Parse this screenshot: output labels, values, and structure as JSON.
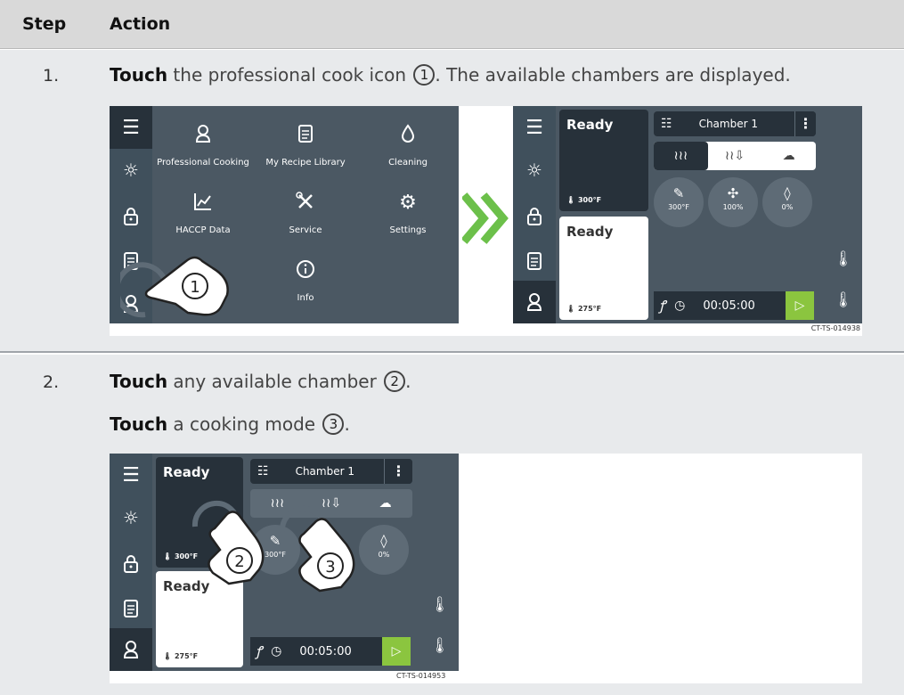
{
  "table": {
    "col_step": "Step",
    "col_action": "Action"
  },
  "steps": [
    {
      "num": "1.",
      "lines": [
        {
          "bold": "Touch",
          "text": " the professional cook icon ",
          "marker": "1",
          "after": ". The available chambers are displayed."
        }
      ],
      "figure": {
        "menu_screen": {
          "tiles": [
            {
              "icon": "chef-hat-icon",
              "label": "Professional Cooking"
            },
            {
              "icon": "recipe-book-icon",
              "label": "My Recipe Library"
            },
            {
              "icon": "droplet-icon",
              "label": "Cleaning"
            },
            {
              "icon": "chart-icon",
              "label": "HACCP Data"
            },
            {
              "icon": "tools-icon",
              "label": "Service"
            },
            {
              "icon": "gear-icon",
              "label": "Settings"
            },
            {
              "icon": "info-icon",
              "label": "Info"
            }
          ]
        },
        "arrow_color": "#6cc04a",
        "chamber_screen": {
          "top_card": {
            "status": "Ready",
            "temp": "300°F"
          },
          "bottom_card": {
            "status": "Ready",
            "temp": "275°F"
          },
          "chamber_label": "Chamber 1",
          "knobs": [
            "300°F",
            "100%",
            "0%"
          ],
          "timer": "00:05:00"
        },
        "callout": "1",
        "code": "CT-TS-014938"
      }
    },
    {
      "num": "2.",
      "lines": [
        {
          "bold": "Touch",
          "text": " any available chamber ",
          "marker": "2",
          "after": "."
        },
        {
          "bold": "Touch",
          "text": " a cooking mode ",
          "marker": "3",
          "after": "."
        }
      ],
      "figure": {
        "chamber_screen": {
          "top_card": {
            "status": "Ready",
            "temp": "300°F"
          },
          "bottom_card": {
            "status": "Ready",
            "temp": "275°F"
          },
          "chamber_label": "Chamber 1",
          "knobs": [
            "300°F",
            "0%"
          ],
          "timer": "00:05:00"
        },
        "callouts": [
          "2",
          "3"
        ],
        "code": "CT-TS-014953"
      }
    }
  ],
  "colors": {
    "screen": "#4b5863",
    "sidebar": "#40505c",
    "dark_panel": "#27313a",
    "accent_green": "#8bc53f"
  }
}
